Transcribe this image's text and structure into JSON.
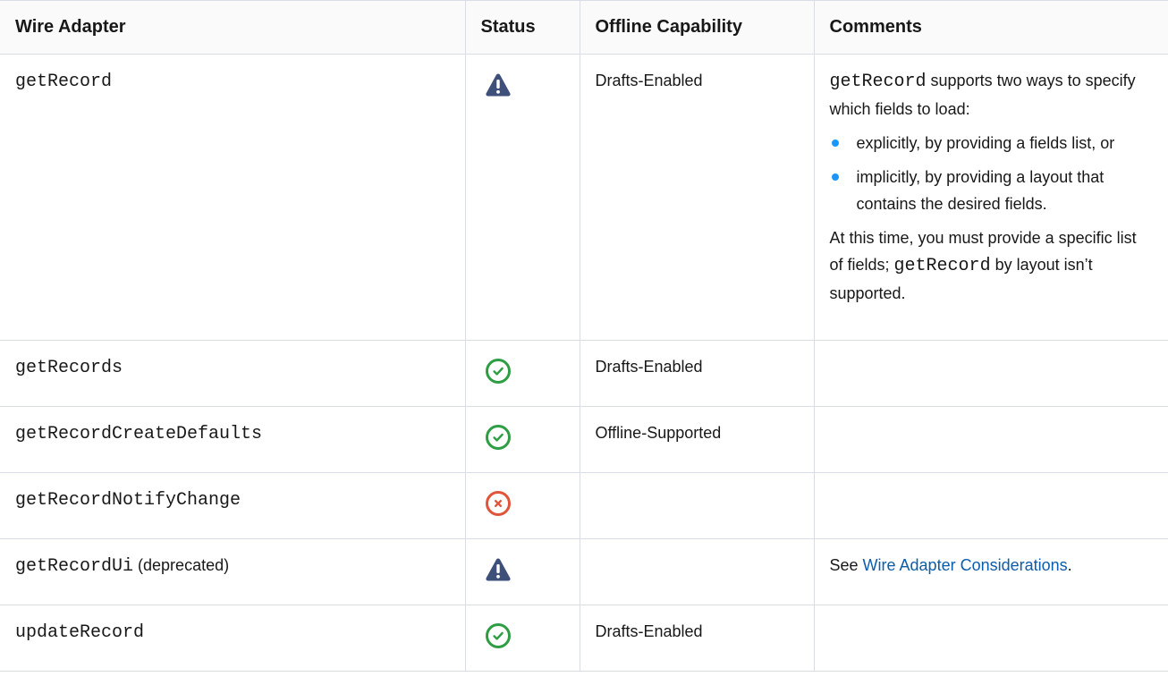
{
  "columns": {
    "adapter": "Wire Adapter",
    "status": "Status",
    "offline": "Offline Capability",
    "comments": "Comments"
  },
  "status_icons": {
    "warning": {
      "name": "warning-icon",
      "color": "#3e4f7a"
    },
    "supported": {
      "name": "check-circle-icon",
      "color": "#2e9e44"
    },
    "unsupported": {
      "name": "x-circle-icon",
      "color": "#e0553a"
    }
  },
  "link_color": "#0b5cab",
  "bullet_color": "#1b96ff",
  "rows": [
    {
      "adapter": "getRecord",
      "adapter_suffix": "",
      "status": "warning",
      "offline": "Drafts-Enabled",
      "comments": {
        "intro_code": "getRecord",
        "intro_text": " supports two ways to specify which fields to load:",
        "bullets": [
          "explicitly, by providing a fields list, or",
          "implicitly, by providing a layout that contains the desired fields."
        ],
        "outro_before": "At this time, you must provide a specific list of fields; ",
        "outro_code": "getRecord",
        "outro_after": " by layout isn’t supported."
      }
    },
    {
      "adapter": "getRecords",
      "adapter_suffix": "",
      "status": "supported",
      "offline": "Drafts-Enabled"
    },
    {
      "adapter": "getRecordCreateDefaults",
      "adapter_suffix": "",
      "status": "supported",
      "offline": "Offline-Supported"
    },
    {
      "adapter": "getRecordNotifyChange",
      "adapter_suffix": "",
      "status": "unsupported",
      "offline": ""
    },
    {
      "adapter": "getRecordUi",
      "adapter_suffix": " (deprecated)",
      "status": "warning",
      "offline": "",
      "comments": {
        "see_prefix": "See ",
        "link_text": "Wire Adapter Considerations",
        "see_suffix": "."
      }
    },
    {
      "adapter": "updateRecord",
      "adapter_suffix": "",
      "status": "supported",
      "offline": "Drafts-Enabled"
    }
  ]
}
